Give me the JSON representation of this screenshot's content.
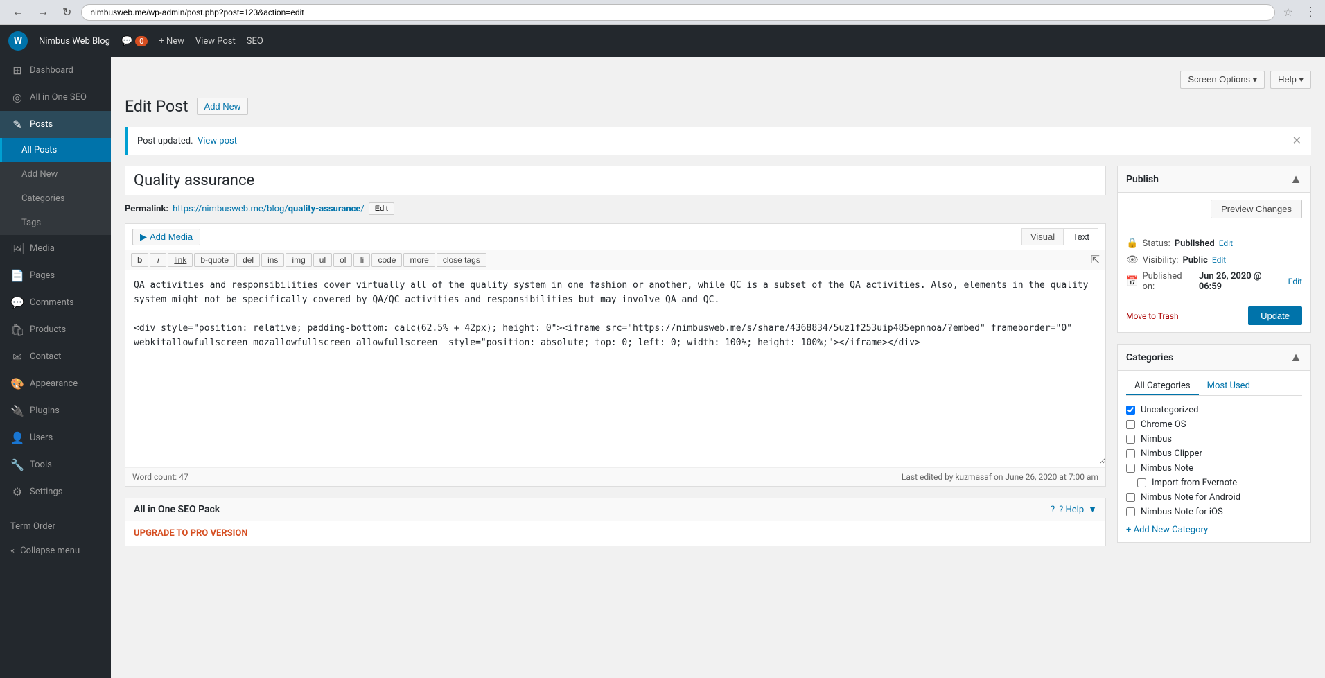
{
  "browser": {
    "address": "nimbusweb.me/wp-admin/post.php?post=123&action=edit",
    "back_title": "Back",
    "forward_title": "Forward",
    "reload_title": "Reload"
  },
  "admin_bar": {
    "site_name": "Nimbus Web Blog",
    "comment_count": "0",
    "new_label": "+ New",
    "view_post_label": "View Post",
    "seo_label": "SEO",
    "logo_letter": "W"
  },
  "screen_options": {
    "label": "Screen Options ▾",
    "help_label": "Help ▾"
  },
  "page": {
    "title": "Edit Post",
    "add_new_label": "Add New"
  },
  "notice": {
    "text": "Post updated.",
    "link_text": "View post",
    "link_url": "#"
  },
  "sidebar": {
    "items": [
      {
        "id": "dashboard",
        "label": "Dashboard",
        "icon": "⊞"
      },
      {
        "id": "all-in-one-seo",
        "label": "All in One SEO",
        "icon": "◎"
      },
      {
        "id": "posts",
        "label": "Posts",
        "icon": "✎",
        "active": true
      },
      {
        "id": "media",
        "label": "Media",
        "icon": "🖼"
      },
      {
        "id": "pages",
        "label": "Pages",
        "icon": "📄"
      },
      {
        "id": "comments",
        "label": "Comments",
        "icon": "💬"
      },
      {
        "id": "products",
        "label": "Products",
        "icon": "🛍"
      },
      {
        "id": "contact",
        "label": "Contact",
        "icon": "✉"
      },
      {
        "id": "appearance",
        "label": "Appearance",
        "icon": "🎨"
      },
      {
        "id": "plugins",
        "label": "Plugins",
        "icon": "🔌"
      },
      {
        "id": "users",
        "label": "Users",
        "icon": "👤"
      },
      {
        "id": "tools",
        "label": "Tools",
        "icon": "🔧"
      },
      {
        "id": "settings",
        "label": "Settings",
        "icon": "⚙"
      }
    ],
    "submenu": {
      "posts": [
        {
          "id": "all-posts",
          "label": "All Posts",
          "active": true
        },
        {
          "id": "add-new",
          "label": "Add New"
        },
        {
          "id": "categories",
          "label": "Categories"
        },
        {
          "id": "tags",
          "label": "Tags"
        }
      ]
    },
    "term_order": "Term Order",
    "collapse_menu": "Collapse menu"
  },
  "editor": {
    "post_title": "Quality assurance",
    "permalink_label": "Permalink:",
    "permalink_url": "https://nimbusweb.me/blog/quality-assurance/",
    "permalink_url_display": "https://nimbusweb.me/blog/quality-assurance/",
    "edit_btn": "Edit",
    "add_media_label": "Add Media",
    "visual_tab": "Visual",
    "text_tab": "Text",
    "format_buttons": [
      "b",
      "i",
      "link",
      "b-quote",
      "del",
      "ins",
      "img",
      "ul",
      "ol",
      "li",
      "code",
      "more",
      "close tags"
    ],
    "content": "QA activities and responsibilities cover virtually all of the quality system in one fashion or another, while QC is a subset of the QA activities. Also, elements in the quality system might not be specifically covered by QA/QC activities and responsibilities but may involve QA and QC.\n\n<div style=\"position: relative; padding-bottom: calc(62.5% + 42px); height: 0\"><iframe src=\"https://nimbusweb.me/s/share/4368834/5uz1f253uip485epnnoa/?embed\" frameborder=\"0\" webkitallowfullscreen mozallowfullscreen allowfullscreen  style=\"position: absolute; top: 0; left: 0; width: 100%; height: 100%;\"></iframe></div>",
    "word_count_label": "Word count:",
    "word_count": "47",
    "last_edited": "Last edited by kuzmasaf on June 26, 2020 at 7:00 am"
  },
  "seo_pack": {
    "title": "All in One SEO Pack",
    "help_label": "? Help",
    "upgrade_label": "UPGRADE TO PRO VERSION",
    "upgrade_url": "#"
  },
  "publish_panel": {
    "title": "Publish",
    "preview_btn": "Preview Changes",
    "status_label": "Status:",
    "status_value": "Published",
    "status_edit": "Edit",
    "visibility_label": "Visibility:",
    "visibility_value": "Public",
    "visibility_edit": "Edit",
    "published_label": "Published on:",
    "published_value": "Jun 26, 2020 @ 06:59",
    "published_edit": "Edit",
    "move_to_trash": "Move to Trash",
    "update_btn": "Update"
  },
  "categories_panel": {
    "title": "Categories",
    "all_tab": "All Categories",
    "most_used_tab": "Most Used",
    "items": [
      {
        "id": "uncategorized",
        "label": "Uncategorized",
        "checked": true,
        "indent": false
      },
      {
        "id": "chrome-os",
        "label": "Chrome OS",
        "checked": false,
        "indent": false
      },
      {
        "id": "nimbus",
        "label": "Nimbus",
        "checked": false,
        "indent": false
      },
      {
        "id": "nimbus-clipper",
        "label": "Nimbus Clipper",
        "checked": false,
        "indent": false
      },
      {
        "id": "nimbus-note",
        "label": "Nimbus Note",
        "checked": false,
        "indent": false
      },
      {
        "id": "import-from-evernote",
        "label": "Import from Evernote",
        "checked": false,
        "indent": true
      },
      {
        "id": "nimbus-note-android",
        "label": "Nimbus Note for Android",
        "checked": false,
        "indent": false
      },
      {
        "id": "nimbus-note-ios",
        "label": "Nimbus Note for iOS",
        "checked": false,
        "indent": false
      }
    ],
    "add_new": "+ Add New Category"
  }
}
